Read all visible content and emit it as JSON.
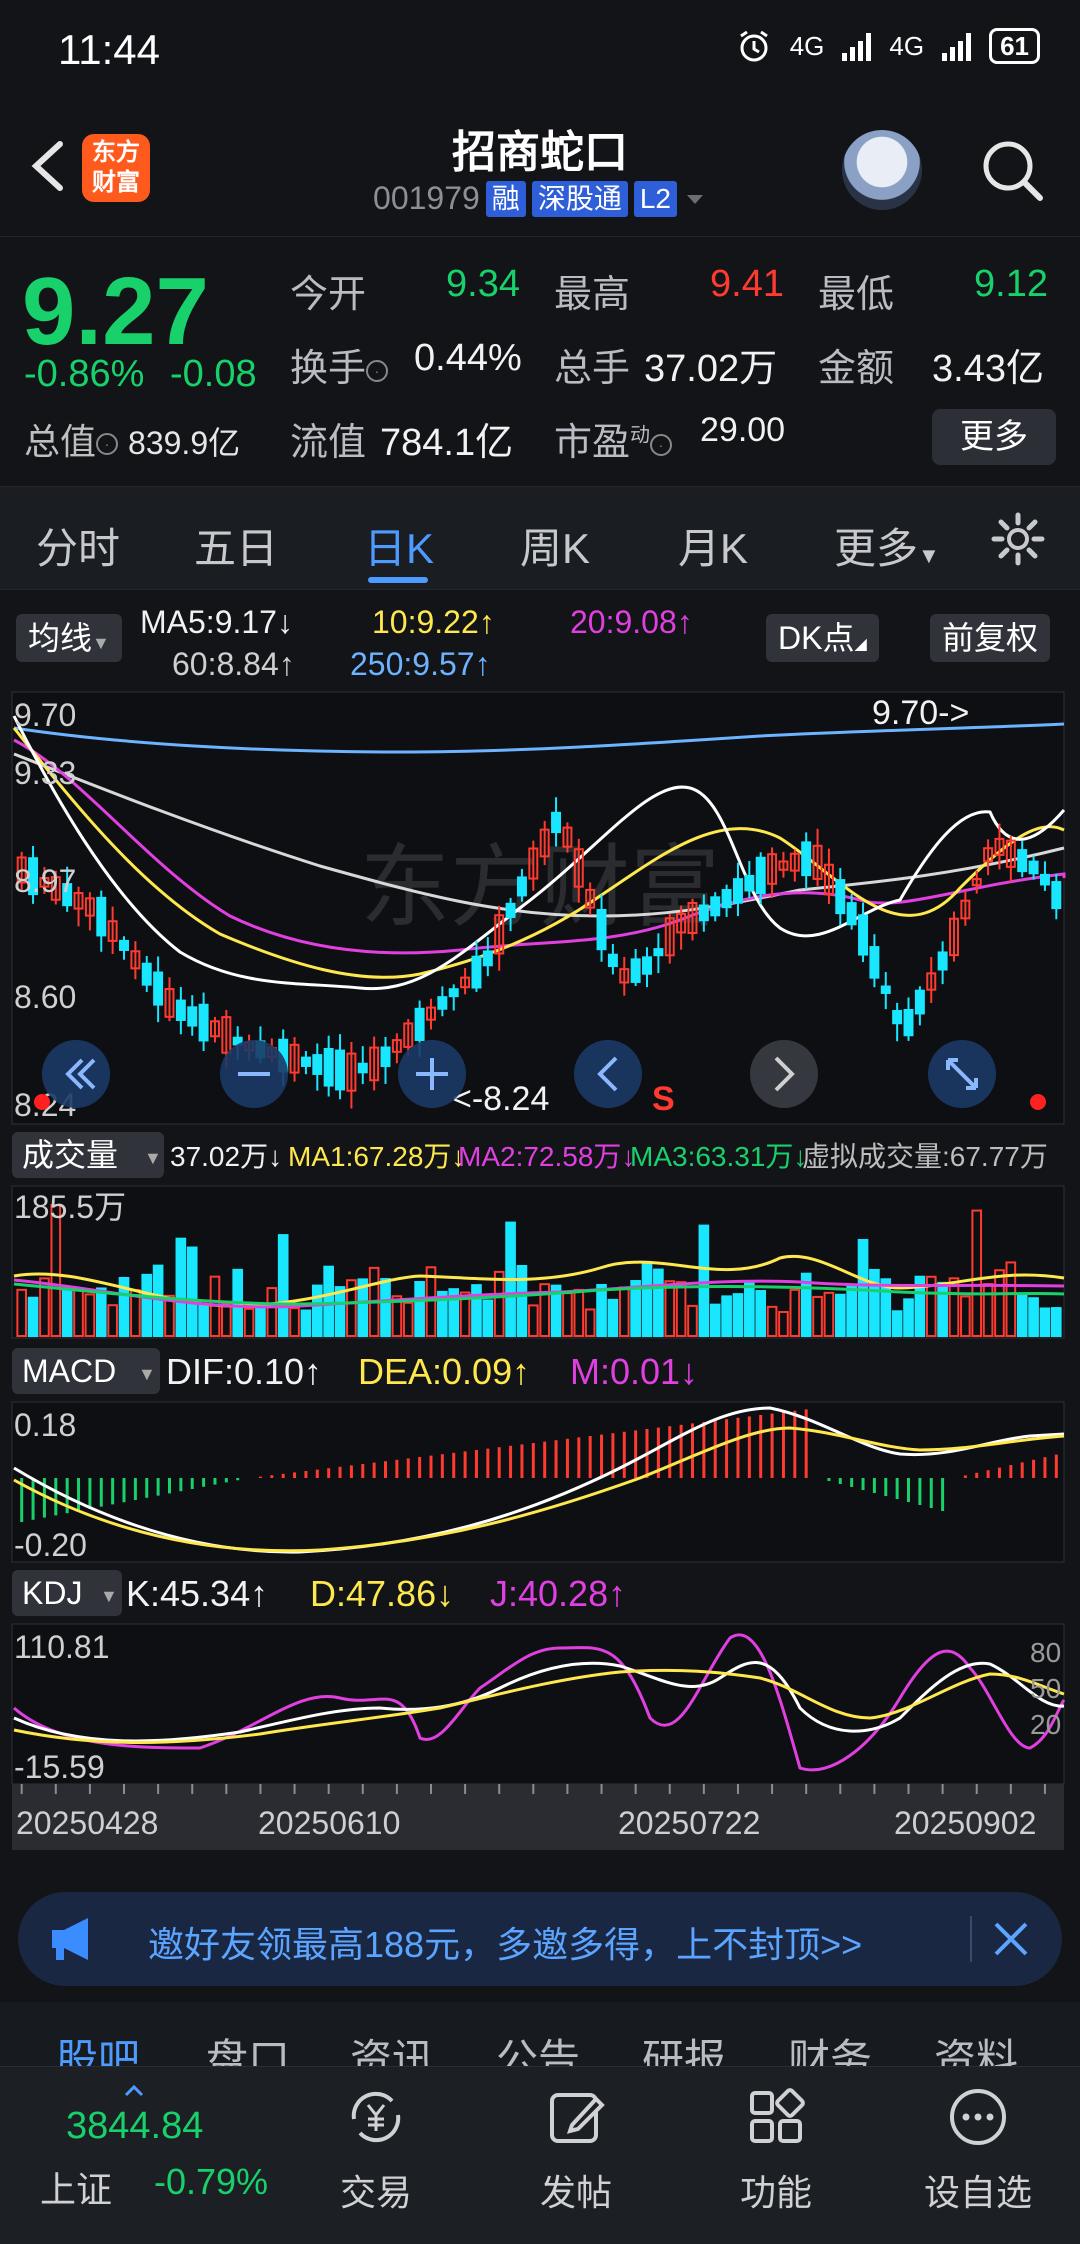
{
  "status_bar": {
    "time": "11:44",
    "network1": "4G",
    "network2": "4G",
    "battery": "61"
  },
  "header": {
    "logo_text_line1": "东方",
    "logo_text_line2": "财富",
    "stock_name": "招商蛇口",
    "stock_code": "001979",
    "tags": [
      "融",
      "深股通",
      "L2"
    ]
  },
  "quote": {
    "price": "9.27",
    "change_pct": "-0.86%",
    "change_amt": "-0.08",
    "total_mv_label": "总值",
    "total_mv_value": "839.9亿",
    "open_label": "今开",
    "open_value": "9.34",
    "high_label": "最高",
    "high_value": "9.41",
    "low_label": "最低",
    "low_value": "9.12",
    "turnover_label": "换手",
    "turnover_value": "0.44%",
    "volume_label": "总手",
    "volume_value": "37.02万",
    "amount_label": "金额",
    "amount_value": "3.43亿",
    "float_mv_label": "流值",
    "float_mv_value": "784.1亿",
    "pe_label": "市盈",
    "pe_sup": "动",
    "pe_value": "29.00",
    "more_label": "更多"
  },
  "tabs": [
    "分时",
    "五日",
    "日K",
    "周K",
    "月K",
    "更多"
  ],
  "ma_row": {
    "selector": "均线",
    "ma5": "MA5:9.17↓",
    "ma10": "10:9.22↑",
    "ma20": "20:9.08↑",
    "ma60": "60:8.84↑",
    "ma250": "250:9.57↑",
    "dk_label": "DK点",
    "adjust_label": "前复权"
  },
  "kline": {
    "y_labels": [
      "9.70",
      "9.33",
      "8.97",
      "8.60",
      "8.24"
    ],
    "high_marker": "9.70->",
    "low_marker": "<-8.24",
    "signal": "S",
    "watermark": "东方财富"
  },
  "volume": {
    "selector": "成交量",
    "vol": "37.02万↓",
    "ma1": "MA1:67.28万↓",
    "ma2": "MA2:72.58万↓",
    "ma3": "MA3:63.31万↓",
    "virtual": "虚拟成交量:67.77万",
    "y_max": "185.5万"
  },
  "macd": {
    "selector": "MACD",
    "dif": "DIF:0.10↑",
    "dea": "DEA:0.09↑",
    "m": "M:0.01↓",
    "y_top": "0.18",
    "y_bottom": "-0.20"
  },
  "kdj": {
    "selector": "KDJ",
    "k": "K:45.34↑",
    "d": "D:47.86↓",
    "j": "J:40.28↑",
    "y_top": "110.81",
    "y_bottom": "-15.59",
    "right_levels": [
      "80",
      "50",
      "20"
    ]
  },
  "x_axis": [
    "20250428",
    "20250610",
    "20250722",
    "20250902"
  ],
  "banner": {
    "text": "邀好友领最高188元，多邀多得，上不封顶>>"
  },
  "bottom_tabs": [
    "股吧",
    "盘口",
    "资讯",
    "公告",
    "研报",
    "财务",
    "资料"
  ],
  "bottom_nav": {
    "index_value": "3844.84",
    "index_name": "上证",
    "index_change": "-0.79%",
    "items": [
      "交易",
      "发帖",
      "功能",
      "设自选"
    ]
  },
  "colors": {
    "up": "#ff3b30",
    "down": "#19d16b",
    "accent": "#4d9bff",
    "bg": "#121418"
  }
}
